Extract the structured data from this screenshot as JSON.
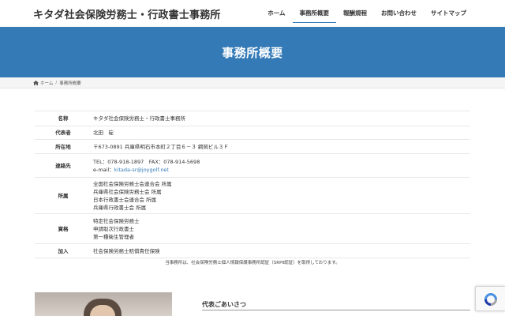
{
  "header": {
    "site_title": "キタダ社会保険労務士・行政書士事務所",
    "nav": [
      "ホーム",
      "事務所概要",
      "報酬規程",
      "お問い合わせ",
      "サイトマップ"
    ],
    "active_nav": "事務所概要"
  },
  "hero": {
    "title": "事務所概要"
  },
  "breadcrumb": {
    "home": "ホーム",
    "separator": "/",
    "current": "事務所概要",
    "home_icon": "home-icon"
  },
  "office": {
    "rows": [
      {
        "label": "名称",
        "lines": [
          "キタダ社会保険労務士・行政書士事務所"
        ]
      },
      {
        "label": "代表者",
        "lines": [
          "北田　碇"
        ]
      },
      {
        "label": "所在地",
        "lines": [
          "〒673-0891 兵庫県明石市本町２丁目６－３ 綱岡ビル３Ｆ"
        ]
      },
      {
        "label": "連絡先",
        "lines": [
          "TEL：078-918-1897　FAX：078-914-5698"
        ],
        "email_prefix": "e-mail：",
        "email": "kitada-sr@joygolf.net"
      },
      {
        "label": "所属",
        "lines": [
          "全国社会保険労務士会連合会 所属",
          "兵庫県社会保険労務士会 所属",
          "日本行政書士会連合会 所属",
          "兵庫県行政書士会 所属"
        ]
      },
      {
        "label": "資格",
        "lines": [
          "特定社会保険労務士",
          "申請取次行政書士",
          "第一種衛生管理者"
        ]
      },
      {
        "label": "加入",
        "lines": [
          "社会保険労務士賠償責任保険"
        ]
      }
    ],
    "note": "当事務所は、社会保険労務士個人情報保護事務所認証（SRPⅡ認証）を取得しております。"
  },
  "greeting": {
    "title": "代表ごあいさつ"
  },
  "colors": {
    "accent": "#337ab7",
    "breadcrumb_bg": "#f5f5f5"
  }
}
